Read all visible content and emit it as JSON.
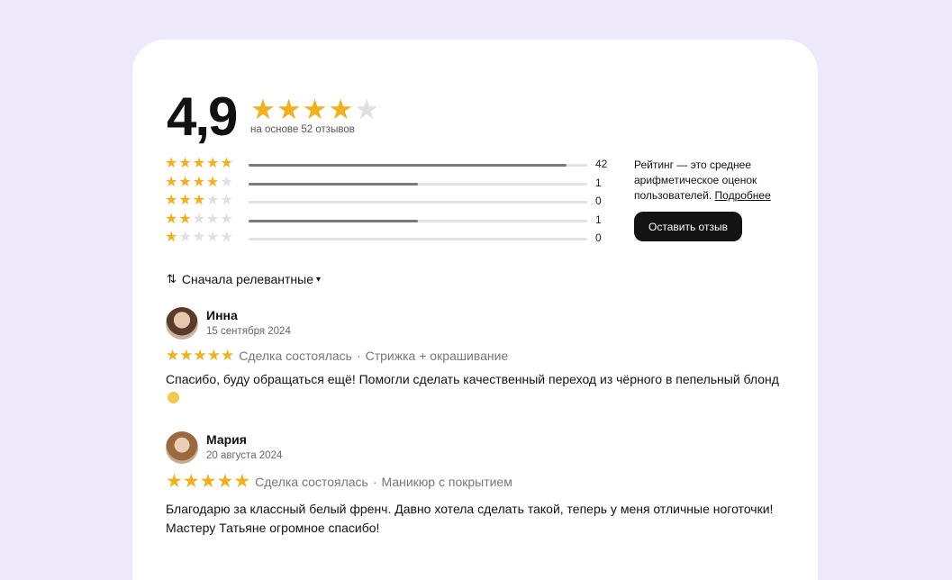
{
  "colors": {
    "page_background": "#eee8fb",
    "card_background": "#ffffff",
    "star_filled": "#f2b01e",
    "star_empty": "#e0e0e0",
    "bar_fill": "#7a7a7a",
    "bar_track": "#e2e2e2",
    "button_background": "#141414"
  },
  "summary": {
    "rating": "4,9",
    "rating_stars_filled": 4,
    "stars_total": 5,
    "based_on": "на основе 52 отзывов"
  },
  "distribution": [
    {
      "stars": 5,
      "count": "42",
      "fill_fraction": 0.94
    },
    {
      "stars": 4,
      "count": "1",
      "fill_fraction": 0.5
    },
    {
      "stars": 3,
      "count": "0",
      "fill_fraction": 0.0
    },
    {
      "stars": 2,
      "count": "1",
      "fill_fraction": 0.5
    },
    {
      "stars": 1,
      "count": "0",
      "fill_fraction": 0.0
    }
  ],
  "side": {
    "description": "Рейтинг — это среднее арифметическое оценок пользователей.",
    "link_label": "Подробнее",
    "button_label": "Оставить отзыв"
  },
  "sort": {
    "icon": "sort-arrows-icon",
    "label": "Сначала релевантные"
  },
  "reviews": [
    {
      "name": "Инна",
      "date": "15 сентября 2024",
      "stars": 5,
      "status": "Сделка состоялась",
      "service": "Стрижка + окрашивание",
      "text": "Спасибо, буду обращаться ещё! Помогли сделать качественный переход из чёрного в пепельный блонд",
      "emoji": "smiling-face-emoji"
    },
    {
      "name": "Мария",
      "date": "20 августа 2024",
      "stars": 5,
      "status": "Сделка состоялась",
      "service": "Маникюр с покрытием",
      "text": "Благодарю за классный белый френч. Давно хотела сделать такой, теперь у меня отличные ноготочки! Мастеру Татьяне огромное спасибо!"
    }
  ]
}
